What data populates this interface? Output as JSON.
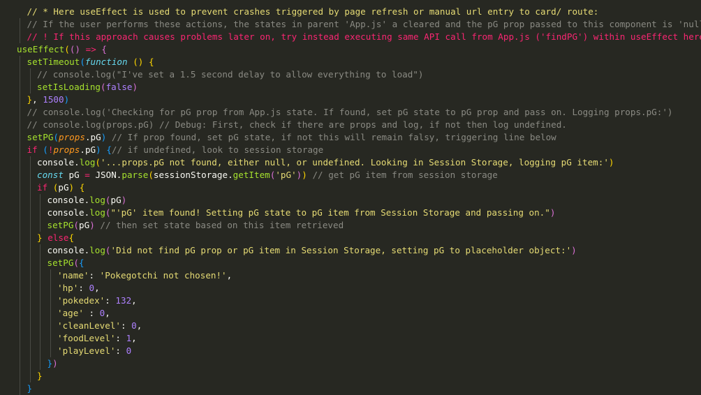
{
  "editor": {
    "language": "javascript",
    "theme_colors": {
      "background": "#272822",
      "comment": "#8a8a83",
      "comment_highlight_yellow": "#e6db74",
      "comment_highlight_red": "#f92672",
      "keyword": "#f92672",
      "function": "#a6e22e",
      "string": "#e6db74",
      "number": "#ae81ff",
      "bracket_gold": "#ffd700",
      "bracket_purple": "#da70d6",
      "bracket_blue": "#179fff"
    },
    "lines": [
      {
        "indent": 1,
        "guides": [],
        "tokens": [
          [
            "cmy",
            "// * Here useEffect is used to prevent crashes triggered by page refresh or manual url entry to card/ route:"
          ]
        ]
      },
      {
        "indent": 1,
        "guides": [
          0
        ],
        "tokens": [
          [
            "cm",
            "// If the user performs these actions, the states in parent 'App.js' a cleared and the pG prop passed to this component is 'null'."
          ]
        ]
      },
      {
        "indent": 1,
        "guides": [
          0
        ],
        "tokens": [
          [
            "cmr",
            "// ! If this approach causes problems later on, try instead executing same API call from App.js ('findPG') within useEffect here!"
          ]
        ]
      },
      {
        "indent": 0,
        "guides": [],
        "tokens": [
          [
            "fn",
            "useEffect"
          ],
          [
            "b1",
            "("
          ],
          [
            "b2",
            "()"
          ],
          [
            "punc",
            " "
          ],
          [
            "op",
            "=>"
          ],
          [
            "punc",
            " "
          ],
          [
            "b2",
            "{"
          ]
        ]
      },
      {
        "indent": 1,
        "guides": [
          0
        ],
        "tokens": [
          [
            "fn",
            "setTimeout"
          ],
          [
            "b3",
            "("
          ],
          [
            "kwi",
            "function"
          ],
          [
            "punc",
            " "
          ],
          [
            "b1",
            "()"
          ],
          [
            "punc",
            " "
          ],
          [
            "b1",
            "{"
          ]
        ]
      },
      {
        "indent": 2,
        "guides": [
          0,
          1
        ],
        "tokens": [
          [
            "cm",
            "// console.log(\"I've set a 1.5 second delay to allow everything to load\")"
          ]
        ]
      },
      {
        "indent": 2,
        "guides": [
          0,
          1
        ],
        "tokens": [
          [
            "fn",
            "setIsLoading"
          ],
          [
            "b2",
            "("
          ],
          [
            "bool",
            "false"
          ],
          [
            "b2",
            ")"
          ]
        ]
      },
      {
        "indent": 1,
        "guides": [
          0
        ],
        "tokens": [
          [
            "b1",
            "}"
          ],
          [
            "punc",
            ", "
          ],
          [
            "num",
            "1500"
          ],
          [
            "b3",
            ")"
          ]
        ]
      },
      {
        "indent": 1,
        "guides": [
          0
        ],
        "tokens": [
          [
            "cm",
            "// console.log('Checking for pG prop from App.js state. If found, set pG state to pG prop and pass on. Logging props.pG:')"
          ]
        ]
      },
      {
        "indent": 1,
        "guides": [
          0
        ],
        "tokens": [
          [
            "cm",
            "// console.log(props.pG) // Debug: First, check if there are props and log, if not then log undefined."
          ]
        ]
      },
      {
        "indent": 1,
        "guides": [
          0
        ],
        "tokens": [
          [
            "fn",
            "setPG"
          ],
          [
            "b3",
            "("
          ],
          [
            "param",
            "props"
          ],
          [
            "punc",
            ".pG"
          ],
          [
            "b3",
            ")"
          ],
          [
            "punc",
            " "
          ],
          [
            "cm",
            "// If prop found, set pG state, if not this will remain falsy, triggering line below"
          ]
        ]
      },
      {
        "indent": 1,
        "guides": [
          0
        ],
        "tokens": [
          [
            "kw",
            "if"
          ],
          [
            "punc",
            " "
          ],
          [
            "b3",
            "("
          ],
          [
            "op",
            "!"
          ],
          [
            "param",
            "props"
          ],
          [
            "punc",
            ".pG"
          ],
          [
            "b3",
            ")"
          ],
          [
            "punc",
            " "
          ],
          [
            "b3",
            "{"
          ],
          [
            "cm",
            "// if undefined, look to session storage"
          ]
        ]
      },
      {
        "indent": 2,
        "guides": [
          0,
          1
        ],
        "tokens": [
          [
            "var",
            "console"
          ],
          [
            "punc",
            "."
          ],
          [
            "fn",
            "log"
          ],
          [
            "b1",
            "("
          ],
          [
            "str",
            "'...props.pG not found, either null, or undefined. Looking in Session Storage, logging pG item:'"
          ],
          [
            "b1",
            ")"
          ]
        ]
      },
      {
        "indent": 2,
        "guides": [
          0,
          1
        ],
        "tokens": [
          [
            "kwi",
            "const"
          ],
          [
            "punc",
            " pG "
          ],
          [
            "op",
            "="
          ],
          [
            "punc",
            " "
          ],
          [
            "var",
            "JSON"
          ],
          [
            "punc",
            "."
          ],
          [
            "fn",
            "parse"
          ],
          [
            "b1",
            "("
          ],
          [
            "var",
            "sessionStorage"
          ],
          [
            "punc",
            "."
          ],
          [
            "fn",
            "getItem"
          ],
          [
            "b2",
            "("
          ],
          [
            "str",
            "'pG'"
          ],
          [
            "b2",
            ")"
          ],
          [
            "b1",
            ")"
          ],
          [
            "punc",
            " "
          ],
          [
            "cm",
            "// get pG item from session storage"
          ]
        ]
      },
      {
        "indent": 2,
        "guides": [
          0,
          1
        ],
        "tokens": [
          [
            "kw",
            "if"
          ],
          [
            "punc",
            " "
          ],
          [
            "b1",
            "("
          ],
          [
            "var",
            "pG"
          ],
          [
            "b1",
            ")"
          ],
          [
            "punc",
            " "
          ],
          [
            "b1",
            "{"
          ]
        ]
      },
      {
        "indent": 3,
        "guides": [
          0,
          1,
          2
        ],
        "tokens": [
          [
            "var",
            "console"
          ],
          [
            "punc",
            "."
          ],
          [
            "fn",
            "log"
          ],
          [
            "b2",
            "("
          ],
          [
            "var",
            "pG"
          ],
          [
            "b2",
            ")"
          ]
        ]
      },
      {
        "indent": 3,
        "guides": [
          0,
          1,
          2
        ],
        "tokens": [
          [
            "var",
            "console"
          ],
          [
            "punc",
            "."
          ],
          [
            "fn",
            "log"
          ],
          [
            "b2",
            "("
          ],
          [
            "str",
            "\"'pG' item found! Setting pG state to pG item from Session Storage and passing on.\""
          ],
          [
            "b2",
            ")"
          ]
        ]
      },
      {
        "indent": 3,
        "guides": [
          0,
          1,
          2
        ],
        "tokens": [
          [
            "fn",
            "setPG"
          ],
          [
            "b2",
            "("
          ],
          [
            "var",
            "pG"
          ],
          [
            "b2",
            ")"
          ],
          [
            "punc",
            " "
          ],
          [
            "cm",
            "// then set state based on this item retrieved"
          ]
        ]
      },
      {
        "indent": 2,
        "guides": [
          0,
          1
        ],
        "tokens": [
          [
            "b1",
            "}"
          ],
          [
            "punc",
            " "
          ],
          [
            "kw",
            "else"
          ],
          [
            "b1",
            "{"
          ]
        ]
      },
      {
        "indent": 3,
        "guides": [
          0,
          1,
          2
        ],
        "tokens": [
          [
            "var",
            "console"
          ],
          [
            "punc",
            "."
          ],
          [
            "fn",
            "log"
          ],
          [
            "b2",
            "("
          ],
          [
            "str",
            "'Did not find pG prop or pG item in Session Storage, setting pG to placeholder object:'"
          ],
          [
            "b2",
            ")"
          ]
        ]
      },
      {
        "indent": 3,
        "guides": [
          0,
          1,
          2
        ],
        "tokens": [
          [
            "fn",
            "setPG"
          ],
          [
            "b2",
            "("
          ],
          [
            "b3",
            "{"
          ]
        ]
      },
      {
        "indent": 4,
        "guides": [
          0,
          1,
          2,
          3
        ],
        "tokens": [
          [
            "str",
            "'name'"
          ],
          [
            "punc",
            ": "
          ],
          [
            "str",
            "'Pokegotchi not chosen!'"
          ],
          [
            "punc",
            ","
          ]
        ]
      },
      {
        "indent": 4,
        "guides": [
          0,
          1,
          2,
          3
        ],
        "tokens": [
          [
            "str",
            "'hp'"
          ],
          [
            "punc",
            ": "
          ],
          [
            "num",
            "0"
          ],
          [
            "punc",
            ","
          ]
        ]
      },
      {
        "indent": 4,
        "guides": [
          0,
          1,
          2,
          3
        ],
        "tokens": [
          [
            "str",
            "'pokedex'"
          ],
          [
            "punc",
            ": "
          ],
          [
            "num",
            "132"
          ],
          [
            "punc",
            ","
          ]
        ]
      },
      {
        "indent": 4,
        "guides": [
          0,
          1,
          2,
          3
        ],
        "tokens": [
          [
            "str",
            "'age'"
          ],
          [
            "punc",
            " : "
          ],
          [
            "num",
            "0"
          ],
          [
            "punc",
            ","
          ]
        ]
      },
      {
        "indent": 4,
        "guides": [
          0,
          1,
          2,
          3
        ],
        "tokens": [
          [
            "str",
            "'cleanLevel'"
          ],
          [
            "punc",
            ": "
          ],
          [
            "num",
            "0"
          ],
          [
            "punc",
            ","
          ]
        ]
      },
      {
        "indent": 4,
        "guides": [
          0,
          1,
          2,
          3
        ],
        "tokens": [
          [
            "str",
            "'foodLevel'"
          ],
          [
            "punc",
            ": "
          ],
          [
            "num",
            "1"
          ],
          [
            "punc",
            ","
          ]
        ]
      },
      {
        "indent": 4,
        "guides": [
          0,
          1,
          2,
          3
        ],
        "tokens": [
          [
            "str",
            "'playLevel'"
          ],
          [
            "punc",
            ": "
          ],
          [
            "num",
            "0"
          ]
        ]
      },
      {
        "indent": 3,
        "guides": [
          0,
          1,
          2
        ],
        "tokens": [
          [
            "b3",
            "}"
          ],
          [
            "b2",
            ")"
          ]
        ]
      },
      {
        "indent": 2,
        "guides": [
          0,
          1
        ],
        "tokens": [
          [
            "b1",
            "}"
          ]
        ]
      },
      {
        "indent": 1,
        "guides": [
          0
        ],
        "tokens": [
          [
            "b3",
            "}"
          ]
        ]
      }
    ]
  }
}
